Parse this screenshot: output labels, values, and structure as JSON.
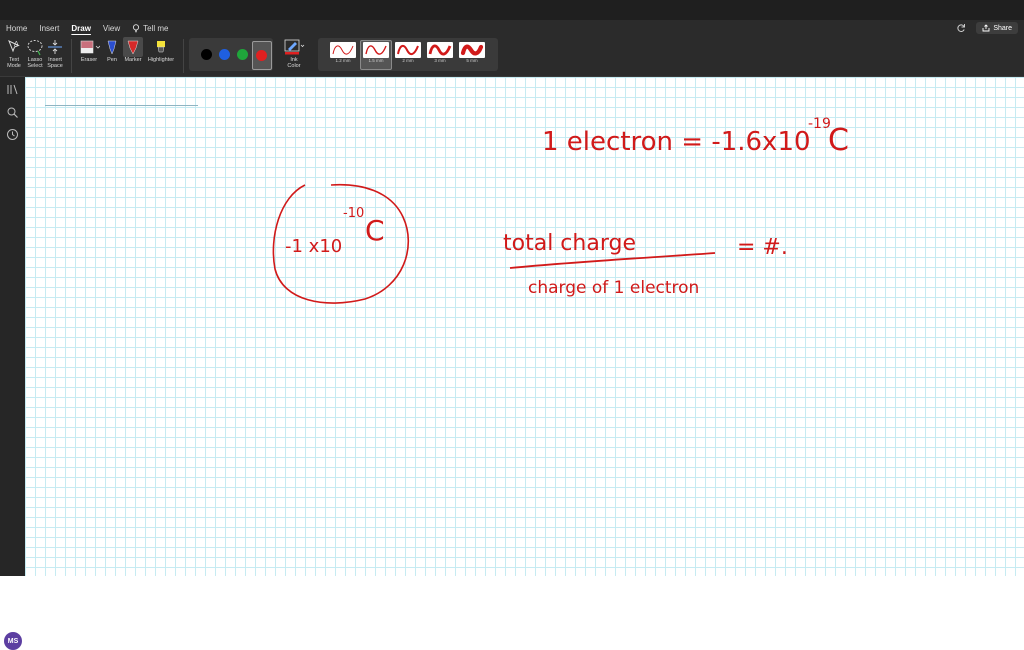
{
  "ribbon": {
    "tabs": [
      {
        "label": "Home"
      },
      {
        "label": "Insert"
      },
      {
        "label": "Draw"
      },
      {
        "label": "View"
      }
    ],
    "tell_me": "Tell me",
    "share_label": "Share",
    "tools": {
      "text_mode": [
        "Text",
        "Mode"
      ],
      "lasso_select": [
        "Lasso",
        "Select"
      ],
      "insert_space": [
        "Insert",
        "Space"
      ],
      "eraser": "Eraser",
      "pen": "Pen",
      "marker": "Marker",
      "highlighter": "Highlighter",
      "ink_color": [
        "Ink",
        "Color"
      ]
    },
    "colors": [
      "#000000",
      "#1f5fe0",
      "#1fa53b",
      "#e02020"
    ],
    "selected_color": "#e02020",
    "widths": [
      {
        "label": "1.2 mm",
        "selected": false
      },
      {
        "label": "1.5 mm",
        "selected": true
      },
      {
        "label": "2 mm",
        "selected": false
      },
      {
        "label": "3 mm",
        "selected": false
      },
      {
        "label": "5 mm",
        "selected": false
      }
    ]
  },
  "user": {
    "initials": "MS"
  },
  "ink_notes": {
    "line1": {
      "prefix": "1 electron = -1.6x10",
      "exp": "-19",
      "unit": "C"
    },
    "circled": {
      "base": "-1 x10",
      "exp": "-10",
      "unit": "C"
    },
    "numerator": "total charge",
    "denominator": "charge of 1 electron",
    "result": "= #."
  }
}
